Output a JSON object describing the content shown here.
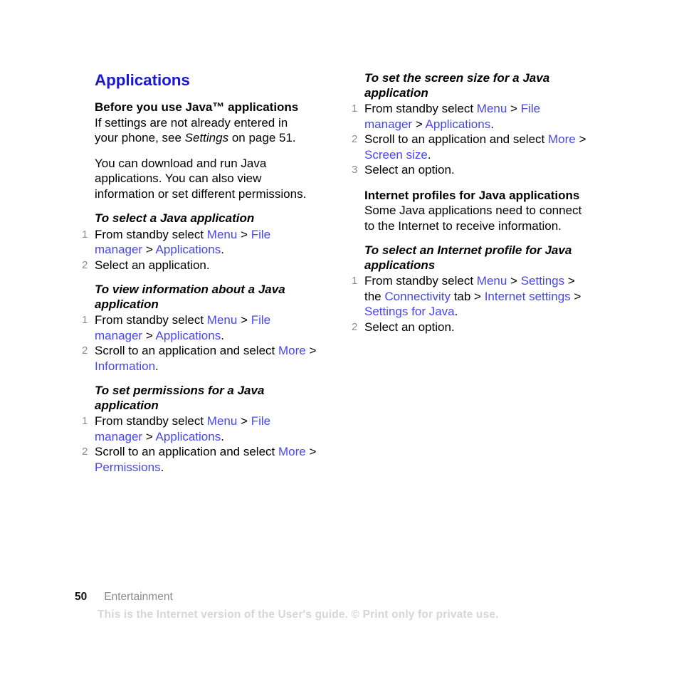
{
  "document": {
    "page_number": "50",
    "section_name": "Entertainment",
    "disclaimer": "This is the Internet version of the User's guide. © Print only for private use.",
    "colors": {
      "chapter_heading": "#1a1ad6",
      "link": "#4646f0",
      "body_text": "#000000",
      "step_number": "#8c8c8c",
      "footer_section": "#8a8a8a",
      "footer_disclaimer": "#d6d6d6"
    }
  },
  "left_column": {
    "chapter_title": "Applications",
    "intro": {
      "heading": "Before you use Java™ applications",
      "line1": "If settings are not already entered in",
      "line2_pre": "your phone, see ",
      "line2_italic": "Settings",
      "line2_post": " on page 51."
    },
    "paragraph": "You can download and run Java applications. You can also view information or set different permissions.",
    "procedures": [
      {
        "title": "To select a Java application",
        "steps": [
          {
            "num": "1",
            "parts": [
              {
                "text": "From standby select ",
                "style": "plain"
              },
              {
                "text": "Menu",
                "style": "link"
              },
              {
                "text": " > ",
                "style": "plain"
              },
              {
                "text": "File manager",
                "style": "link"
              },
              {
                "text": " > ",
                "style": "plain"
              },
              {
                "text": "Applications",
                "style": "link"
              },
              {
                "text": ".",
                "style": "plain"
              }
            ]
          },
          {
            "num": "2",
            "parts": [
              {
                "text": "Select an application.",
                "style": "plain"
              }
            ]
          }
        ]
      },
      {
        "title": "To view information about a Java application",
        "steps": [
          {
            "num": "1",
            "parts": [
              {
                "text": "From standby select ",
                "style": "plain"
              },
              {
                "text": "Menu",
                "style": "link"
              },
              {
                "text": " > ",
                "style": "plain"
              },
              {
                "text": "File manager",
                "style": "link"
              },
              {
                "text": " > ",
                "style": "plain"
              },
              {
                "text": "Applications",
                "style": "link"
              },
              {
                "text": ".",
                "style": "plain"
              }
            ]
          },
          {
            "num": "2",
            "parts": [
              {
                "text": "Scroll to an application and select ",
                "style": "plain"
              },
              {
                "text": "More",
                "style": "link"
              },
              {
                "text": " > ",
                "style": "plain"
              },
              {
                "text": "Information",
                "style": "link"
              },
              {
                "text": ".",
                "style": "plain"
              }
            ]
          }
        ]
      },
      {
        "title": "To set permissions for a Java application",
        "steps": [
          {
            "num": "1",
            "parts": [
              {
                "text": "From standby select ",
                "style": "plain"
              },
              {
                "text": "Menu",
                "style": "link"
              },
              {
                "text": " > ",
                "style": "plain"
              },
              {
                "text": "File manager",
                "style": "link"
              },
              {
                "text": " > ",
                "style": "plain"
              },
              {
                "text": "Applications",
                "style": "link"
              },
              {
                "text": ".",
                "style": "plain"
              }
            ]
          },
          {
            "num": "2",
            "parts": [
              {
                "text": "Scroll to an application and select ",
                "style": "plain"
              },
              {
                "text": "More",
                "style": "link"
              },
              {
                "text": " > ",
                "style": "plain"
              },
              {
                "text": "Permissions",
                "style": "link"
              },
              {
                "text": ".",
                "style": "plain"
              }
            ]
          }
        ]
      }
    ]
  },
  "right_column": {
    "procedures_top": [
      {
        "title": "To set the screen size for a Java application",
        "steps": [
          {
            "num": "1",
            "parts": [
              {
                "text": "From standby select ",
                "style": "plain"
              },
              {
                "text": "Menu",
                "style": "link"
              },
              {
                "text": " > ",
                "style": "plain"
              },
              {
                "text": "File manager",
                "style": "link"
              },
              {
                "text": " > ",
                "style": "plain"
              },
              {
                "text": "Applications",
                "style": "link"
              },
              {
                "text": ".",
                "style": "plain"
              }
            ]
          },
          {
            "num": "2",
            "parts": [
              {
                "text": "Scroll to an application and select ",
                "style": "plain"
              },
              {
                "text": "More",
                "style": "link"
              },
              {
                "text": " > ",
                "style": "plain"
              },
              {
                "text": "Screen size",
                "style": "link"
              },
              {
                "text": ".",
                "style": "plain"
              }
            ]
          },
          {
            "num": "3",
            "parts": [
              {
                "text": "Select an option.",
                "style": "plain"
              }
            ]
          }
        ]
      }
    ],
    "internet_profiles": {
      "heading": "Internet profiles for Java applications",
      "paragraph": "Some Java applications need to connect to the Internet to receive information."
    },
    "procedures_bottom": [
      {
        "title": "To select an Internet profile for Java applications",
        "steps": [
          {
            "num": "1",
            "parts": [
              {
                "text": "From standby select ",
                "style": "plain"
              },
              {
                "text": "Menu",
                "style": "link"
              },
              {
                "text": " > ",
                "style": "plain"
              },
              {
                "text": "Settings",
                "style": "link"
              },
              {
                "text": " > the ",
                "style": "plain"
              },
              {
                "text": "Connectivity",
                "style": "link"
              },
              {
                "text": " tab > ",
                "style": "plain"
              },
              {
                "text": "Internet settings",
                "style": "link"
              },
              {
                "text": " > ",
                "style": "plain"
              },
              {
                "text": "Settings for Java",
                "style": "link"
              },
              {
                "text": ".",
                "style": "plain"
              }
            ]
          },
          {
            "num": "2",
            "parts": [
              {
                "text": "Select an option.",
                "style": "plain"
              }
            ]
          }
        ]
      }
    ]
  }
}
